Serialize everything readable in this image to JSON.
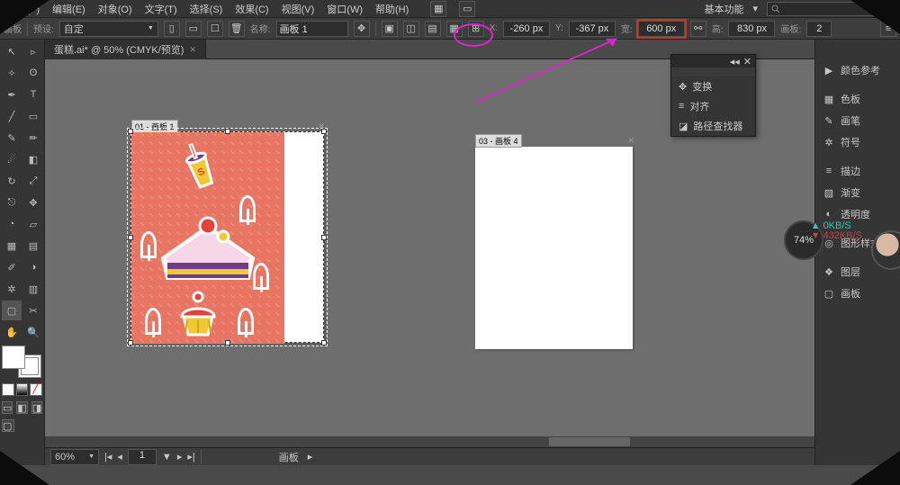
{
  "menubar": {
    "items": [
      "文件(F)",
      "编辑(E)",
      "对象(O)",
      "文字(T)",
      "选择(S)",
      "效果(C)",
      "视图(V)",
      "窗口(W)",
      "帮助(H)"
    ],
    "workspace_label": "基本功能"
  },
  "controlbar": {
    "tool_label": "画板",
    "preset_label": "预设:",
    "preset_value": "自定",
    "name_label": "名称:",
    "name_value": "画板 1",
    "x_label": "X:",
    "x_value": "-260 px",
    "y_label": "Y:",
    "y_value": "-367 px",
    "w_label": "宽:",
    "w_value": "600 px",
    "h_label": "高:",
    "h_value": "830 px",
    "artboards_label": "画板:",
    "artboards_value": "2"
  },
  "document": {
    "tab_title": "蛋糕.ai* @ 50% (CMYK/预览)"
  },
  "artboards": {
    "ab1_label": "01 - 画板 1",
    "ab2_label": "03 - 画板 4"
  },
  "statusbar": {
    "zoom": "60%",
    "nav_value": "1",
    "panel_label": "画板"
  },
  "floatpanel": {
    "items": [
      "变换",
      "对齐",
      "路径查找器"
    ]
  },
  "rightpanel": {
    "items": [
      "颜色参考",
      "色板",
      "画笔",
      "符号",
      "描边",
      "渐变",
      "透明度",
      "图形样式",
      "图层",
      "画板"
    ]
  },
  "badge": {
    "pct": "74%",
    "up": "▲ 0KB/S",
    "down": "▼ 432KB/S"
  }
}
